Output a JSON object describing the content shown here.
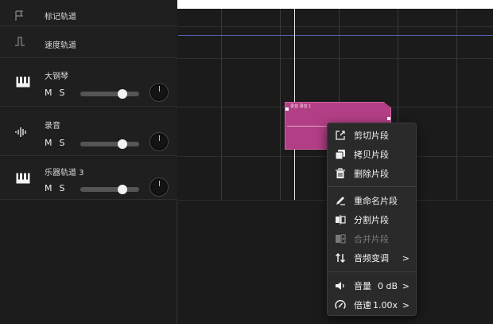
{
  "tracks": {
    "marker": {
      "name": "标记轨道"
    },
    "speed": {
      "name": "速度轨道"
    },
    "items": [
      {
        "name": "大钢琴",
        "m": "M",
        "s": "S",
        "volume": 0.75,
        "icon": "piano-icon"
      },
      {
        "name": "录音",
        "m": "M",
        "s": "S",
        "volume": 0.75,
        "icon": "waveform-icon"
      },
      {
        "name": "乐器轨道 3",
        "m": "M",
        "s": "S",
        "volume": 0.75,
        "icon": "piano-icon"
      }
    ]
  },
  "clip": {
    "title": "录音·录音 1",
    "color": "#b23f86"
  },
  "menu": {
    "items": [
      {
        "label": "剪切片段",
        "icon": "cut-icon",
        "enabled": true
      },
      {
        "label": "拷贝片段",
        "icon": "copy-icon",
        "enabled": true
      },
      {
        "label": "删除片段",
        "icon": "trash-icon",
        "enabled": true
      },
      {
        "label": "重命名片段",
        "icon": "pencil-icon",
        "enabled": true
      },
      {
        "label": "分割片段",
        "icon": "split-icon",
        "enabled": true
      },
      {
        "label": "合并片段",
        "icon": "merge-icon",
        "enabled": false
      },
      {
        "label": "音频变调",
        "icon": "transpose-icon",
        "enabled": true,
        "arrow": ">"
      },
      {
        "label": "音量",
        "value": "0 dB",
        "icon": "speaker-icon",
        "enabled": true,
        "arrow": ">"
      },
      {
        "label": "倍速",
        "value": "1.00x",
        "icon": "speed-gauge-icon",
        "enabled": true,
        "arrow": ">"
      }
    ]
  },
  "colors": {
    "accent_clip": "#b23f86",
    "speed_line": "#4e62b8",
    "background": "#1b1b1b"
  }
}
